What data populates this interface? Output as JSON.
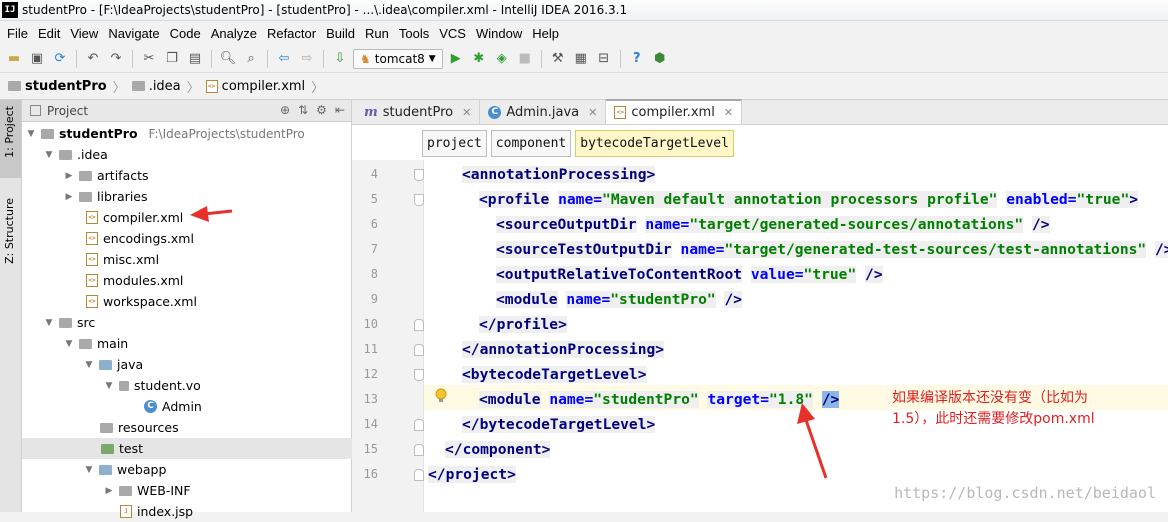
{
  "window": {
    "title": "studentPro - [F:\\IdeaProjects\\studentPro] - [studentPro] - ...\\.idea\\compiler.xml - IntelliJ IDEA 2016.3.1"
  },
  "menu": [
    "File",
    "Edit",
    "View",
    "Navigate",
    "Code",
    "Analyze",
    "Refactor",
    "Build",
    "Run",
    "Tools",
    "VCS",
    "Window",
    "Help"
  ],
  "toolbar": {
    "run_config": "tomcat8"
  },
  "nav": {
    "project": "studentPro",
    "folder": ".idea",
    "file": "compiler.xml"
  },
  "left_tabs": {
    "project": "1: Project",
    "structure": "Z: Structure"
  },
  "project_panel": {
    "title": "Project",
    "tree": [
      {
        "label": "studentPro",
        "path": "F:\\IdeaProjects\\studentPro",
        "icon": "module-folder-icon"
      },
      {
        "label": ".idea",
        "icon": "folder-icon"
      },
      {
        "label": "artifacts",
        "icon": "folder-icon"
      },
      {
        "label": "libraries",
        "icon": "folder-icon"
      },
      {
        "label": "compiler.xml",
        "icon": "xml-file-icon"
      },
      {
        "label": "encodings.xml",
        "icon": "xml-file-icon"
      },
      {
        "label": "misc.xml",
        "icon": "xml-file-icon"
      },
      {
        "label": "modules.xml",
        "icon": "xml-file-icon"
      },
      {
        "label": "workspace.xml",
        "icon": "xml-file-icon"
      },
      {
        "label": "src",
        "icon": "folder-icon"
      },
      {
        "label": "main",
        "icon": "folder-icon"
      },
      {
        "label": "java",
        "icon": "source-folder-icon"
      },
      {
        "label": "student.vo",
        "icon": "package-icon"
      },
      {
        "label": "Admin",
        "icon": "class-icon"
      },
      {
        "label": "resources",
        "icon": "resources-folder-icon"
      },
      {
        "label": "test",
        "icon": "test-folder-icon"
      },
      {
        "label": "webapp",
        "icon": "folder-icon"
      },
      {
        "label": "WEB-INF",
        "icon": "folder-icon"
      },
      {
        "label": "index.jsp",
        "icon": "jsp-file-icon"
      }
    ]
  },
  "editor": {
    "tabs": [
      {
        "label": "studentPro",
        "icon": "maven-icon"
      },
      {
        "label": "Admin.java",
        "icon": "class-icon"
      },
      {
        "label": "compiler.xml",
        "icon": "xml-file-icon",
        "active": true
      }
    ],
    "breadcrumb": [
      "project",
      "component",
      "bytecodeTargetLevel"
    ],
    "lines": [
      {
        "num": "4",
        "indent": 2,
        "code": "<annotationProcessing>"
      },
      {
        "num": "5",
        "indent": 3,
        "code": "<profile name=\"Maven default annotation processors profile\" enabled=\"true\">"
      },
      {
        "num": "6",
        "indent": 4,
        "code": "<sourceOutputDir name=\"target/generated-sources/annotations\" />"
      },
      {
        "num": "7",
        "indent": 4,
        "code": "<sourceTestOutputDir name=\"target/generated-test-sources/test-annotations\" />"
      },
      {
        "num": "8",
        "indent": 4,
        "code": "<outputRelativeToContentRoot value=\"true\" />"
      },
      {
        "num": "9",
        "indent": 4,
        "code": "<module name=\"studentPro\" />"
      },
      {
        "num": "10",
        "indent": 3,
        "code": "</profile>"
      },
      {
        "num": "11",
        "indent": 2,
        "code": "</annotationProcessing>"
      },
      {
        "num": "12",
        "indent": 2,
        "code": "<bytecodeTargetLevel>"
      },
      {
        "num": "13",
        "indent": 3,
        "code": "<module name=\"studentPro\" target=\"1.8\" />"
      },
      {
        "num": "14",
        "indent": 2,
        "code": "</bytecodeTargetLevel>"
      },
      {
        "num": "15",
        "indent": 1,
        "code": "</component>"
      },
      {
        "num": "16",
        "indent": 0,
        "code": "</project>"
      }
    ]
  },
  "annotation": {
    "line1": "如果编译版本还没有变（比如为",
    "line2": "1.5），此时还需要修改pom.xml"
  },
  "watermark": "https://blog.csdn.net/beidaol",
  "colors": {
    "arrow": "#e8302a",
    "tag": "#000080",
    "attr": "#0000ff",
    "value": "#008000"
  }
}
